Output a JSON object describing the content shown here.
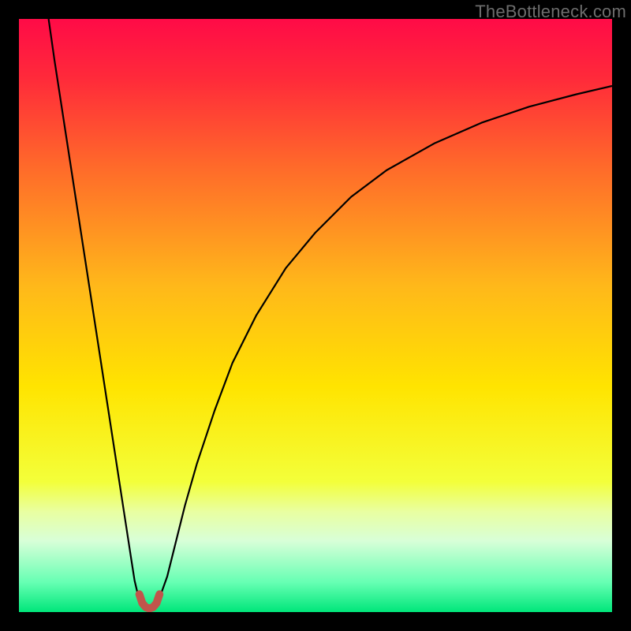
{
  "watermark": "TheBottleneck.com",
  "chart_data": {
    "type": "line",
    "title": "",
    "xlabel": "",
    "ylabel": "",
    "xlim": [
      0,
      100
    ],
    "ylim": [
      0,
      100
    ],
    "grid": false,
    "gradient_stops": [
      {
        "offset": 0.0,
        "color": "#ff0b47"
      },
      {
        "offset": 0.1,
        "color": "#ff2a3a"
      },
      {
        "offset": 0.25,
        "color": "#ff6a2a"
      },
      {
        "offset": 0.45,
        "color": "#ffb81a"
      },
      {
        "offset": 0.62,
        "color": "#ffe400"
      },
      {
        "offset": 0.78,
        "color": "#f3ff3a"
      },
      {
        "offset": 0.83,
        "color": "#e9ffa0"
      },
      {
        "offset": 0.88,
        "color": "#d8ffd8"
      },
      {
        "offset": 0.95,
        "color": "#66ffb3"
      },
      {
        "offset": 1.0,
        "color": "#00e67a"
      }
    ],
    "series": [
      {
        "name": "left-curve-black",
        "color": "#000000",
        "width": 2.2,
        "x": [
          5,
          6,
          7,
          8,
          9,
          10,
          11,
          12,
          13,
          14,
          15,
          16,
          17,
          18,
          19,
          19.5,
          20,
          20.5
        ],
        "y": [
          100,
          93,
          86.5,
          80,
          73.5,
          67,
          60.5,
          54,
          47.5,
          41,
          34.5,
          28,
          21.5,
          15,
          8.5,
          5.3,
          3.2,
          2.4
        ]
      },
      {
        "name": "right-curve-black",
        "color": "#000000",
        "width": 2.2,
        "x": [
          23.5,
          24,
          25,
          26,
          28,
          30,
          33,
          36,
          40,
          45,
          50,
          56,
          62,
          70,
          78,
          86,
          94,
          100
        ],
        "y": [
          2.4,
          3.2,
          6,
          10,
          18,
          25,
          34,
          42,
          50,
          58,
          64,
          70,
          74.5,
          79,
          82.5,
          85.2,
          87.3,
          88.7
        ]
      },
      {
        "name": "trough-highlight",
        "color": "#c1554b",
        "width": 10,
        "linecap": "round",
        "x": [
          20.3,
          20.8,
          21.4,
          22.0,
          22.6,
          23.2,
          23.7
        ],
        "y": [
          3.0,
          1.5,
          0.8,
          0.6,
          0.8,
          1.5,
          3.0
        ]
      }
    ]
  }
}
